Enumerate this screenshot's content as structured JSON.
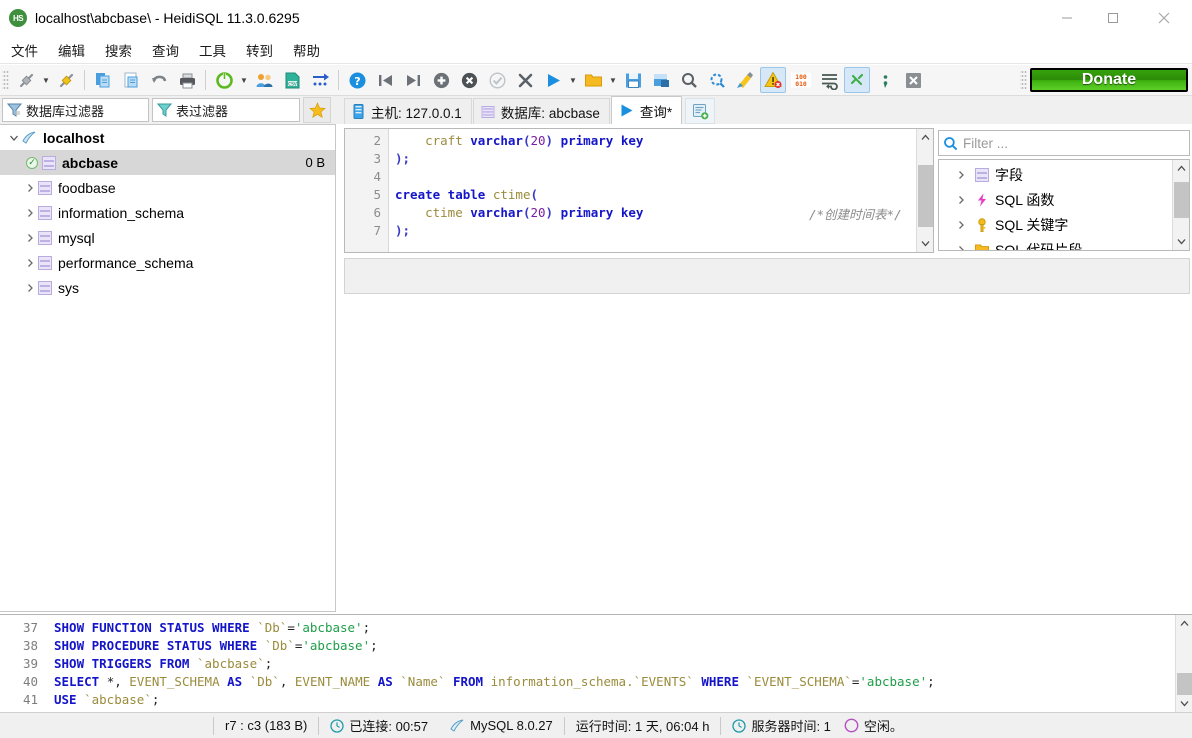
{
  "window": {
    "title": "localhost\\abcbase\\ - HeidiSQL 11.3.0.6295",
    "app_icon": "HS",
    "minimize_label": "—",
    "maximize_label": "□",
    "close_label": "✕"
  },
  "menu": {
    "items": [
      {
        "label": "文件"
      },
      {
        "label": "编辑"
      },
      {
        "label": "搜索"
      },
      {
        "label": "查询"
      },
      {
        "label": "工具"
      },
      {
        "label": "转到"
      },
      {
        "label": "帮助"
      }
    ]
  },
  "toolbar": {
    "donate_label": "Donate",
    "donate_color": "#36a30c",
    "buttons": [
      {
        "name": "connect-icon"
      },
      {
        "name": "connect-dropdown-arrow-icon"
      },
      {
        "name": "disconnect-icon"
      },
      {
        "name": "copy-icon"
      },
      {
        "name": "paste-icon"
      },
      {
        "name": "undo-icon"
      },
      {
        "name": "print-icon"
      },
      {
        "name": "refresh-icon"
      },
      {
        "name": "refresh-dropdown-arrow-icon"
      },
      {
        "name": "users-icon"
      },
      {
        "name": "export-csv-icon"
      },
      {
        "name": "import-icon"
      },
      {
        "name": "help-icon"
      },
      {
        "name": "first-icon"
      },
      {
        "name": "last-icon"
      },
      {
        "name": "insert-row-icon"
      },
      {
        "name": "delete-row-icon"
      },
      {
        "name": "apply-icon"
      },
      {
        "name": "cancel-icon"
      },
      {
        "name": "execute-icon"
      },
      {
        "name": "execute-dropdown-arrow-icon"
      },
      {
        "name": "open-folder-icon"
      },
      {
        "name": "open-dropdown-arrow-icon"
      },
      {
        "name": "save-icon"
      },
      {
        "name": "save-as-icon"
      },
      {
        "name": "find-icon"
      },
      {
        "name": "replace-icon"
      },
      {
        "name": "format-sql-icon"
      },
      {
        "name": "toggle-warnings-icon"
      },
      {
        "name": "binary-data-icon"
      },
      {
        "name": "word-wrap-icon"
      },
      {
        "name": "sql-help-icon"
      },
      {
        "name": "semicolon-icon"
      },
      {
        "name": "stop-icon"
      }
    ]
  },
  "filters": {
    "database_filter_placeholder": "数据库过滤器",
    "table_filter_placeholder": "表过滤器",
    "favorite_icon": "star-icon"
  },
  "tabs": [
    {
      "label": "主机: 127.0.0.1",
      "icon": "host-icon",
      "active": false
    },
    {
      "label": "数据库: abcbase",
      "icon": "database-icon",
      "active": false
    },
    {
      "label": "查询*",
      "icon": "play-icon",
      "active": true
    }
  ],
  "tab_add_button": "new-query-tab-icon",
  "tree": {
    "root": {
      "label": "localhost",
      "icon": "server-icon",
      "expanded": true
    },
    "items": [
      {
        "label": "abcbase",
        "size": "0 B",
        "selected": true,
        "connected": true
      },
      {
        "label": "foodbase",
        "size": "",
        "selected": false,
        "connected": false
      },
      {
        "label": "information_schema",
        "size": "",
        "selected": false,
        "connected": false
      },
      {
        "label": "mysql",
        "size": "",
        "selected": false,
        "connected": false
      },
      {
        "label": "performance_schema",
        "size": "",
        "selected": false,
        "connected": false
      },
      {
        "label": "sys",
        "size": "",
        "selected": false,
        "connected": false
      }
    ]
  },
  "editor": {
    "line_numbers": [
      "2",
      "3",
      "4",
      "5",
      "6",
      "7"
    ],
    "lines": [
      "    craft varchar(20) primary key",
      ");",
      "",
      "create table ctime(",
      "    ctime varchar(20) primary key",
      ");"
    ],
    "inline_comment": "/*创建时间表*/",
    "scroll_up": "▲",
    "scroll_down": "▼"
  },
  "right_panel": {
    "search_placeholder": "Filter ...",
    "search_icon": "search-icon",
    "items": [
      {
        "label": "字段",
        "icon": "columns-icon"
      },
      {
        "label": "SQL 函数",
        "icon": "function-icon"
      },
      {
        "label": "SQL 关键字",
        "icon": "key-icon"
      },
      {
        "label": "SQL 代码片段",
        "icon": "folder-icon"
      }
    ]
  },
  "log": {
    "line_numbers": [
      "37",
      "38",
      "39",
      "40",
      "41"
    ],
    "lines": [
      "SHOW FUNCTION STATUS WHERE `Db`='abcbase';",
      "SHOW PROCEDURE STATUS WHERE `Db`='abcbase';",
      "SHOW TRIGGERS FROM `abcbase`;",
      "SELECT *, EVENT_SCHEMA AS `Db`, EVENT_NAME AS `Name` FROM information_schema.`EVENTS` WHERE `EVENT_SCHEMA`='abcbase';",
      "USE `abcbase`;"
    ]
  },
  "statusbar": {
    "cursor_position": "r7 : c3 (183 B)",
    "connected_label": "已连接: 00:57",
    "connected_icon": "clock-icon",
    "server_version": "MySQL 8.0.27",
    "server_version_icon": "dolphin-icon",
    "uptime": "运行时间: 1 天, 06:04 h",
    "server_time": "服务器时间: 1",
    "server_time_icon": "clock-icon",
    "state": "空闲。",
    "state_icon": "idle-circle-icon"
  }
}
